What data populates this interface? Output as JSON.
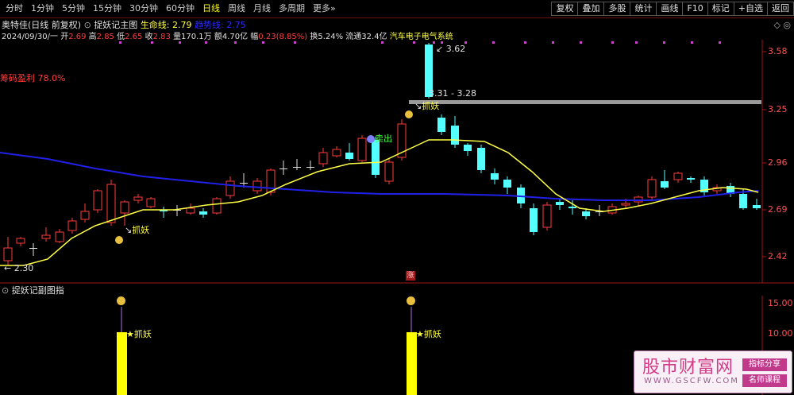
{
  "toolbar": {
    "periods": [
      "分时",
      "1分钟",
      "5分钟",
      "15分钟",
      "30分钟",
      "60分钟",
      "日线",
      "周线",
      "月线",
      "多周期",
      "更多»"
    ],
    "active_period": "日线",
    "right_buttons": [
      "复权",
      "叠加",
      "多股",
      "统计",
      "画线",
      "F10",
      "标记",
      "+自选",
      "返回"
    ]
  },
  "header": {
    "stock_name": "奥特佳(日线 前复权)",
    "indicator_name": "捉妖记主图",
    "lifeline_label": "生命线: 2.79",
    "blue_label": "趋势线: 2.75",
    "date": "2024/09/30/一",
    "open_label": "开",
    "open": "2.69",
    "high_label": "高",
    "high": "2.85",
    "low_label": "低",
    "low": "2.65",
    "close_label": "收",
    "close": "2.83",
    "volume_label": "量",
    "volume": "170.1万",
    "amount_label": "额",
    "amount": "4.70亿",
    "change_label": "幅",
    "change": "0.23(8.85%)",
    "turnover_label": "换",
    "turnover": "5.24%",
    "float_label": "流通",
    "float": "32.4亿",
    "sector": "汽车电子电气系统",
    "win_controls": "◇ ◎"
  },
  "main_chart": {
    "chip_profit": "筹码盈利 78.0%",
    "price_axis": [
      "3.58",
      "3.25",
      "2.96",
      "2.69",
      "2.42"
    ],
    "annotations": {
      "high_label": "3.62",
      "range_label": "3.31 - 3.28",
      "low_label": "2.30",
      "buy1": "抓妖",
      "buy2": "抓妖",
      "sell": "卖出",
      "rise_marker": "涨"
    }
  },
  "sub_chart": {
    "title": "捉妖记副图指",
    "axis": [
      "15.00",
      "10.00"
    ],
    "signal1": "抓妖",
    "signal2": "抓妖"
  },
  "watermark": {
    "title": "股市财富网",
    "url": "WWW.GSCFW.COM",
    "tag1": "指标分享",
    "tag2": "名师课程"
  },
  "colors": {
    "up": "#ff3c3c",
    "down": "#54ffff",
    "lifeline": "#ffff44",
    "trend": "#2020e8",
    "signal": "#ffff00"
  }
}
